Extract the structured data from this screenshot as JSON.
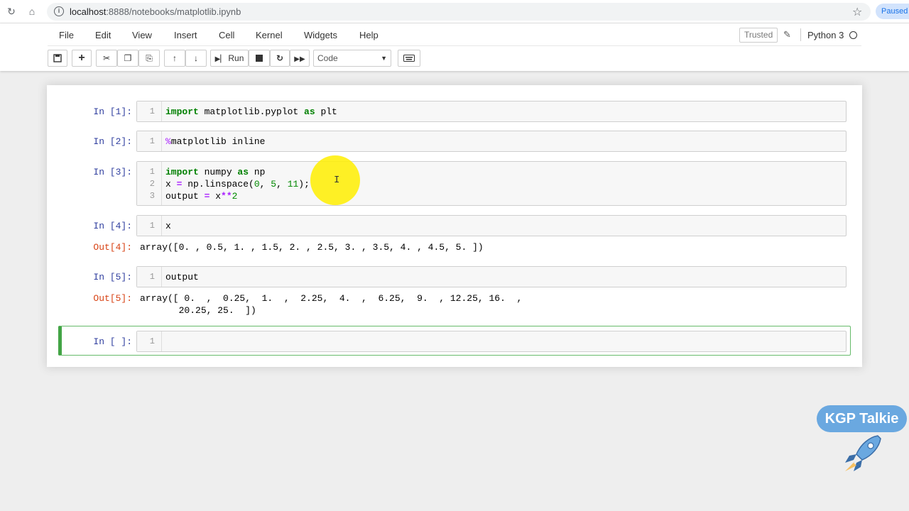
{
  "browser": {
    "url_host": "localhost",
    "url_path": ":8888/notebooks/matplotlib.ipynb",
    "paused_label": "Paused"
  },
  "menu": {
    "items": [
      "File",
      "Edit",
      "View",
      "Insert",
      "Cell",
      "Kernel",
      "Widgets",
      "Help"
    ],
    "trusted_label": "Trusted",
    "kernel_name": "Python 3"
  },
  "toolbar": {
    "run_label": "Run",
    "cell_type": "Code"
  },
  "cells": [
    {
      "prompt": "In [1]:",
      "lines": [
        "import matplotlib.pyplot as plt"
      ]
    },
    {
      "prompt": "In [2]:",
      "lines": [
        "%matplotlib inline"
      ]
    },
    {
      "prompt": "In [3]:",
      "lines": [
        "import numpy as np",
        "x = np.linspace(0, 5, 11);",
        "output = x**2"
      ]
    },
    {
      "prompt": "In [4]:",
      "lines": [
        "x"
      ],
      "out_prompt": "Out[4]:",
      "output": [
        "array([0. , 0.5, 1. , 1.5, 2. , 2.5, 3. , 3.5, 4. , 4.5, 5. ])"
      ]
    },
    {
      "prompt": "In [5]:",
      "lines": [
        "output"
      ],
      "out_prompt": "Out[5]:",
      "output": [
        "array([ 0.  ,  0.25,  1.  ,  2.25,  4.  ,  6.25,  9.  , 12.25, 16.  ,",
        "       20.25, 25.  ])"
      ]
    },
    {
      "prompt": "In [ ]:",
      "lines": [
        ""
      ]
    }
  ],
  "line_numbers": [
    "1",
    "2",
    "3"
  ],
  "watermark": {
    "label": "KGP Talkie"
  },
  "colors": {
    "in_prompt": "#303f9f",
    "out_prompt": "#d84315",
    "selected_cell": "#42a445",
    "keyword": "#008000"
  }
}
